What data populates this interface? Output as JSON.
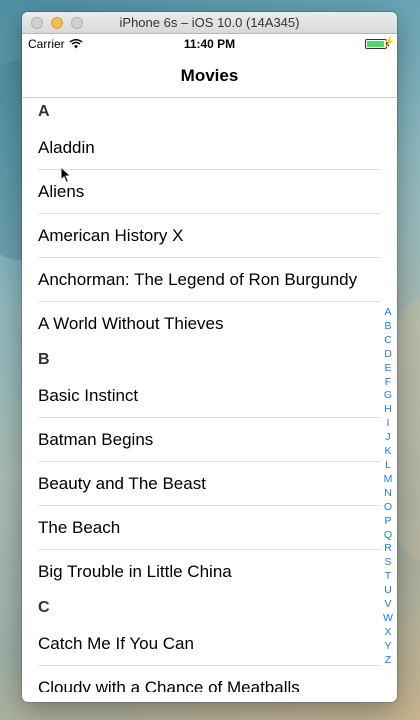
{
  "window": {
    "title": "iPhone 6s – iOS 10.0 (14A345)"
  },
  "status_bar": {
    "carrier": "Carrier",
    "time": "11:40 PM",
    "battery_level": 0.95
  },
  "nav": {
    "title": "Movies"
  },
  "sections": [
    {
      "header": "A",
      "rows": [
        "Aladdin",
        "Aliens",
        "American History X",
        "Anchorman: The Legend of Ron Burgundy",
        "A World Without Thieves"
      ]
    },
    {
      "header": "B",
      "rows": [
        "Basic Instinct",
        "Batman Begins",
        "Beauty and The Beast",
        "The Beach",
        "Big Trouble in Little China"
      ]
    },
    {
      "header": "C",
      "rows": [
        "Catch Me If You Can",
        "Cloudy with a Chance of Meatballs"
      ]
    }
  ],
  "index": [
    "A",
    "B",
    "C",
    "D",
    "E",
    "F",
    "G",
    "H",
    "I",
    "J",
    "K",
    "L",
    "M",
    "N",
    "O",
    "P",
    "Q",
    "R",
    "S",
    "T",
    "U",
    "V",
    "W",
    "X",
    "Y",
    "Z"
  ],
  "colors": {
    "index_accent": "#1a7cf5",
    "battery": "#4cd964"
  }
}
